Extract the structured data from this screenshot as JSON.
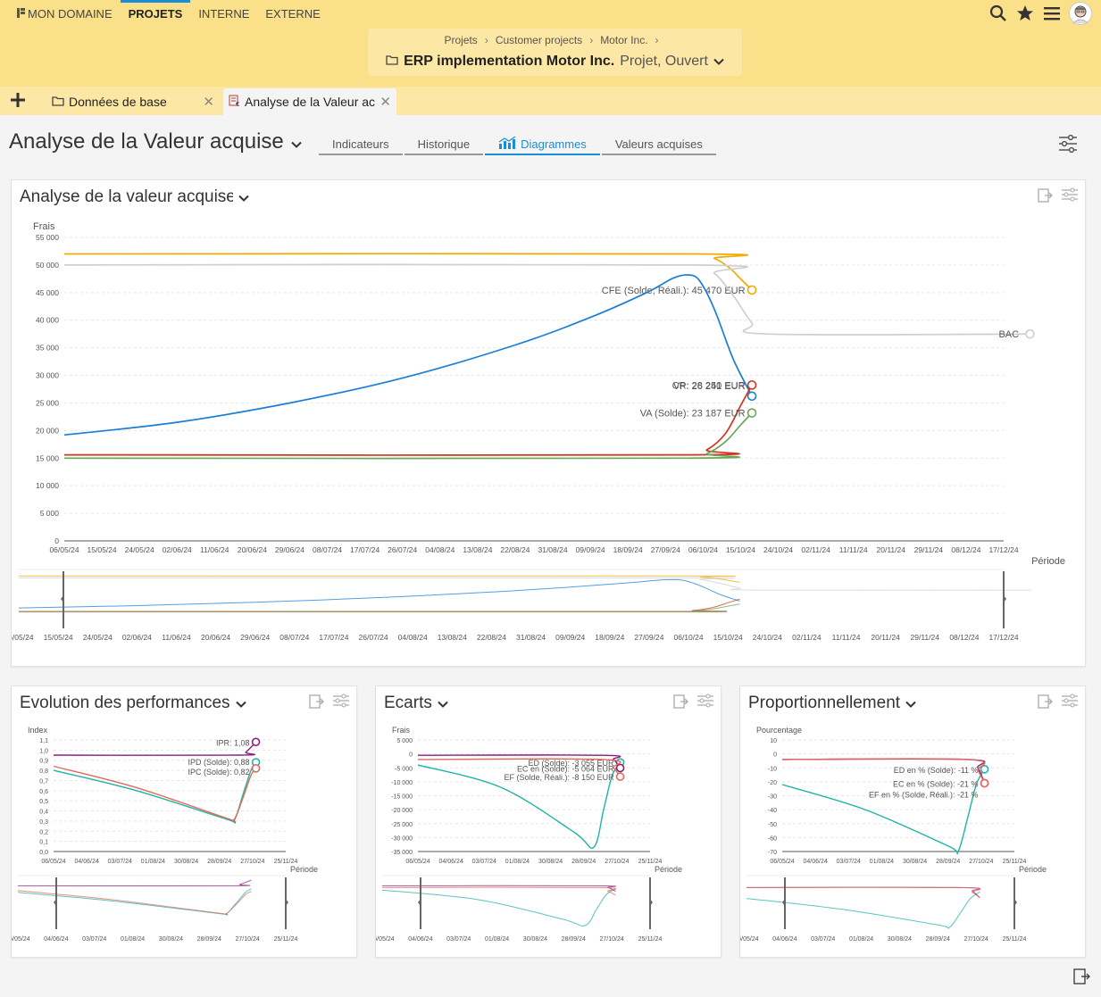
{
  "nav": {
    "items": [
      "MON DOMAINE",
      "PROJETS",
      "INTERNE",
      "EXTERNE"
    ],
    "active": 1
  },
  "breadcrumb": [
    "Projets",
    "Customer projects",
    "Motor Inc."
  ],
  "project": {
    "name": "ERP implementation Motor Inc.",
    "state": "Projet, Ouvert"
  },
  "tabs": [
    {
      "label": "Données de base"
    },
    {
      "label": "Analyse de la Valeur ac"
    }
  ],
  "page": {
    "title": "Analyse de la Valeur acquise"
  },
  "subtabs": [
    "Indicateurs",
    "Historique",
    "Diagrammes",
    "Valeurs acquises"
  ],
  "colors": {
    "accent": "#1a8ed6",
    "header": "#fbe08a",
    "cfe": "#f2a900",
    "bac": "#c8c8c8",
    "cr": "#d0341c",
    "vp": "#1a7fd4",
    "va": "#6aa75a",
    "ipd": "#1fb3a8",
    "ipc": "#8a1f7a",
    "ipr": "#e06a5a"
  },
  "chart_data": [
    {
      "type": "line",
      "title": "Analyse de la valeur acquise",
      "ylabel": "Frais",
      "xlabel": "Période",
      "ylim": [
        0,
        55000
      ],
      "yticks": [
        "0",
        "5 000",
        "10 000",
        "15 000",
        "20 000",
        "25 000",
        "30 000",
        "35 000",
        "40 000",
        "45 000",
        "50 000",
        "55 000"
      ],
      "x_ticks": [
        "06/05/24",
        "15/05/24",
        "24/05/24",
        "02/06/24",
        "11/06/24",
        "20/06/24",
        "29/06/24",
        "08/07/24",
        "17/07/24",
        "26/07/24",
        "04/08/24",
        "13/08/24",
        "22/08/24",
        "31/08/24",
        "09/09/24",
        "18/09/24",
        "27/09/24",
        "06/10/24",
        "15/10/24",
        "24/10/24",
        "02/11/24",
        "11/11/24",
        "20/11/24",
        "29/11/24",
        "08/12/24",
        "17/12/24"
      ],
      "series": [
        {
          "name": "CFE (Solde, Réali.)",
          "label": "CFE (Solde, Réali.): 45 470 EUR",
          "color": "#f2a900",
          "points": [
            [
              0,
              52000
            ],
            [
              16.8,
              52000
            ],
            [
              17.3,
              51200
            ],
            [
              17.7,
              49500
            ],
            [
              18.0,
              47500
            ],
            [
              18.3,
              45470
            ]
          ]
        },
        {
          "name": "BAC",
          "label": "BAC",
          "color": "#cfcfcf",
          "points": [
            [
              0,
              50000
            ],
            [
              16.8,
              50000
            ],
            [
              17.3,
              48500
            ],
            [
              17.8,
              44500
            ],
            [
              18.3,
              39500
            ],
            [
              18.7,
              37500
            ],
            [
              25.7,
              37500
            ]
          ]
        },
        {
          "name": "VP",
          "label": "VP: 26 241 EUR",
          "color": "#1a7fd4",
          "points": [
            [
              0,
              19200
            ],
            [
              3,
              21500
            ],
            [
              6,
              25000
            ],
            [
              9,
              29500
            ],
            [
              12,
              35500
            ],
            [
              14,
              40500
            ],
            [
              15.5,
              45000
            ],
            [
              16.2,
              47600
            ],
            [
              16.6,
              48200
            ],
            [
              16.9,
              47200
            ],
            [
              17.3,
              42000
            ],
            [
              17.8,
              33000
            ],
            [
              18.3,
              26241
            ]
          ]
        },
        {
          "name": "CR",
          "label": "CR: 28 250 EUR",
          "color": "#d0341c",
          "points": [
            [
              0,
              15600
            ],
            [
              16.6,
              15600
            ],
            [
              17.1,
              16500
            ],
            [
              17.6,
              19500
            ],
            [
              18.0,
              24500
            ],
            [
              18.3,
              28250
            ]
          ]
        },
        {
          "name": "VA (Solde)",
          "label": "VA (Solde): 23 187 EUR",
          "color": "#6aa75a",
          "points": [
            [
              0,
              15000
            ],
            [
              16.6,
              15000
            ],
            [
              17.1,
              15800
            ],
            [
              17.6,
              18000
            ],
            [
              18.0,
              21000
            ],
            [
              18.3,
              23187
            ]
          ]
        }
      ]
    },
    {
      "type": "line",
      "title": "Evolution des performances",
      "ylabel": "Index",
      "xlabel": "Période",
      "ylim": [
        0,
        1.1
      ],
      "yticks": [
        "0,0",
        "0,1",
        "0,2",
        "0,3",
        "0,4",
        "0,5",
        "0,6",
        "0,7",
        "0,8",
        "0,9",
        "1,0",
        "1,1"
      ],
      "x_ticks": [
        "06/05/24",
        "04/06/24",
        "03/07/24",
        "01/08/24",
        "30/08/24",
        "28/09/24",
        "27/10/24",
        "25/11/24"
      ],
      "series": [
        {
          "name": "IPR",
          "label": "IPR: 1,08",
          "color": "#8a1f7a",
          "points": [
            [
              0,
              0.95
            ],
            [
              5.6,
              0.95
            ],
            [
              5.8,
              0.98
            ],
            [
              6.1,
              1.08
            ]
          ]
        },
        {
          "name": "IPD (Solde)",
          "label": "IPD (Solde): 0,88",
          "color": "#1fb3a8",
          "points": [
            [
              0,
              0.8
            ],
            [
              2.5,
              0.6
            ],
            [
              5.2,
              0.32
            ],
            [
              5.45,
              0.31
            ],
            [
              5.7,
              0.55
            ],
            [
              5.95,
              0.8
            ],
            [
              6.1,
              0.88
            ]
          ]
        },
        {
          "name": "IPC (Solde)",
          "label": "IPC (Solde): 0,82",
          "color": "#e06a5a",
          "points": [
            [
              0,
              0.84
            ],
            [
              2.5,
              0.63
            ],
            [
              5.2,
              0.33
            ],
            [
              5.45,
              0.32
            ],
            [
              5.7,
              0.52
            ],
            [
              5.95,
              0.75
            ],
            [
              6.1,
              0.82
            ]
          ]
        }
      ]
    },
    {
      "type": "line",
      "title": "Ecarts",
      "ylabel": "Frais",
      "xlabel": "Période",
      "ylim": [
        -35000,
        5000
      ],
      "yticks": [
        "-35 000",
        "-30 000",
        "-25 000",
        "-20 000",
        "-15 000",
        "-10 000",
        "-5 000",
        "0",
        "5 000"
      ],
      "x_ticks": [
        "06/05/24",
        "04/06/24",
        "03/07/24",
        "01/08/24",
        "30/08/24",
        "28/09/24",
        "27/10/24",
        "25/11/24"
      ],
      "series": [
        {
          "name": "ED (Solde)",
          "label": "ED (Solde): -3 055 EUR",
          "color": "#1fb3a8",
          "points": [
            [
              0,
              -4000
            ],
            [
              2.5,
              -12000
            ],
            [
              4.7,
              -28000
            ],
            [
              5.3,
              -33500
            ],
            [
              5.6,
              -20000
            ],
            [
              5.85,
              -8000
            ],
            [
              6.1,
              -3055
            ]
          ]
        },
        {
          "name": "EC en (Solde)",
          "label": "EC en (Solde): -5 064 EUR",
          "color": "#8a1f7a",
          "points": [
            [
              0,
              -500
            ],
            [
              5.6,
              -500
            ],
            [
              5.9,
              -2000
            ],
            [
              6.1,
              -5064
            ]
          ]
        },
        {
          "name": "EF (Solde, Réali.)",
          "label": "EF (Solde, Réali.): -8 150 EUR",
          "color": "#e06a5a",
          "points": [
            [
              0,
              -2000
            ],
            [
              5.6,
              -2000
            ],
            [
              5.9,
              -5000
            ],
            [
              6.1,
              -8150
            ]
          ]
        }
      ]
    },
    {
      "type": "line",
      "title": "Proportionnellement",
      "ylabel": "Pourcentage",
      "xlabel": "Période",
      "ylim": [
        -70,
        10
      ],
      "yticks": [
        "-70",
        "-60",
        "-50",
        "-40",
        "-30",
        "-20",
        "-10",
        "0",
        "10"
      ],
      "x_ticks": [
        "06/05/24",
        "04/06/24",
        "03/07/24",
        "01/08/24",
        "30/08/24",
        "28/09/24",
        "27/10/24",
        "25/11/24"
      ],
      "series": [
        {
          "name": "ED en %",
          "label": "ED en % (Solde): -11 %",
          "color": "#1fb3a8",
          "points": [
            [
              0,
              -22
            ],
            [
              2.5,
              -40
            ],
            [
              5.0,
              -66
            ],
            [
              5.3,
              -70
            ],
            [
              5.6,
              -45
            ],
            [
              5.85,
              -22
            ],
            [
              6.1,
              -11
            ]
          ]
        },
        {
          "name": "EC en %",
          "label": "EC en % (Solde): -21 %",
          "color": "#8a1f7a",
          "points": [
            [
              0,
              -4
            ],
            [
              5.6,
              -4
            ],
            [
              5.9,
              -10
            ],
            [
              6.1,
              -21
            ]
          ]
        },
        {
          "name": "EF en %",
          "label": "EF en % (Solde, Réali.): -21 %",
          "color": "#e06a5a",
          "points": [
            [
              0,
              -4
            ],
            [
              5.6,
              -4
            ],
            [
              5.9,
              -12
            ],
            [
              6.1,
              -21
            ]
          ]
        }
      ]
    }
  ]
}
